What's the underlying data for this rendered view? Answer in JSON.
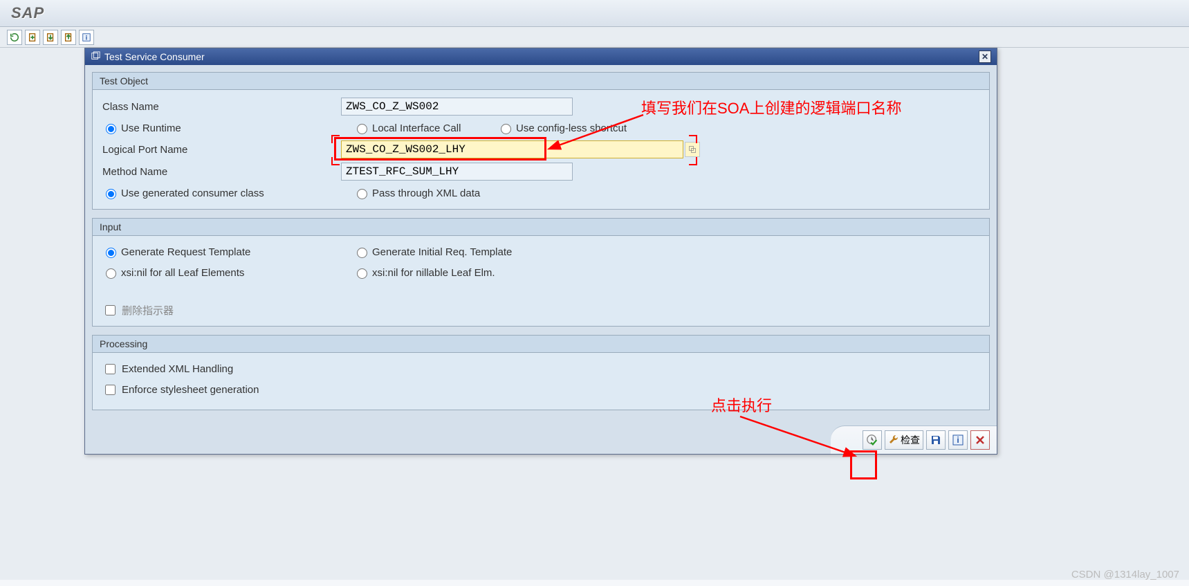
{
  "app": {
    "title": "SAP"
  },
  "dialog": {
    "title": "Test Service Consumer",
    "groups": {
      "test_object": {
        "title": "Test Object",
        "class_name_label": "Class Name",
        "class_name_value": "ZWS_CO_Z_WS002",
        "radio1": {
          "opt1": "Use Runtime",
          "opt2": "Local Interface Call",
          "opt3": "Use config-less shortcut"
        },
        "logical_port_label": "Logical Port Name",
        "logical_port_value": "ZWS_CO_Z_WS002_LHY",
        "method_name_label": "Method Name",
        "method_name_value": "ZTEST_RFC_SUM_LHY",
        "radio2": {
          "opt1": "Use generated consumer class",
          "opt2": "Pass through XML data"
        }
      },
      "input": {
        "title": "Input",
        "radio": {
          "opt1": "Generate Request Template",
          "opt2": "Generate Initial Req. Template"
        },
        "radio2": {
          "opt1": "xsi:nil for all Leaf Elements",
          "opt2": "xsi:nil for nillable Leaf Elm."
        },
        "check1": "删除指示器"
      },
      "processing": {
        "title": "Processing",
        "check1": "Extended XML Handling",
        "check2": "Enforce stylesheet generation"
      }
    },
    "footer": {
      "check_label": "检查"
    }
  },
  "annotations": {
    "a1": "填写我们在SOA上创建的逻辑端口名称",
    "a2": "点击执行"
  },
  "watermark": "CSDN @1314lay_1007"
}
